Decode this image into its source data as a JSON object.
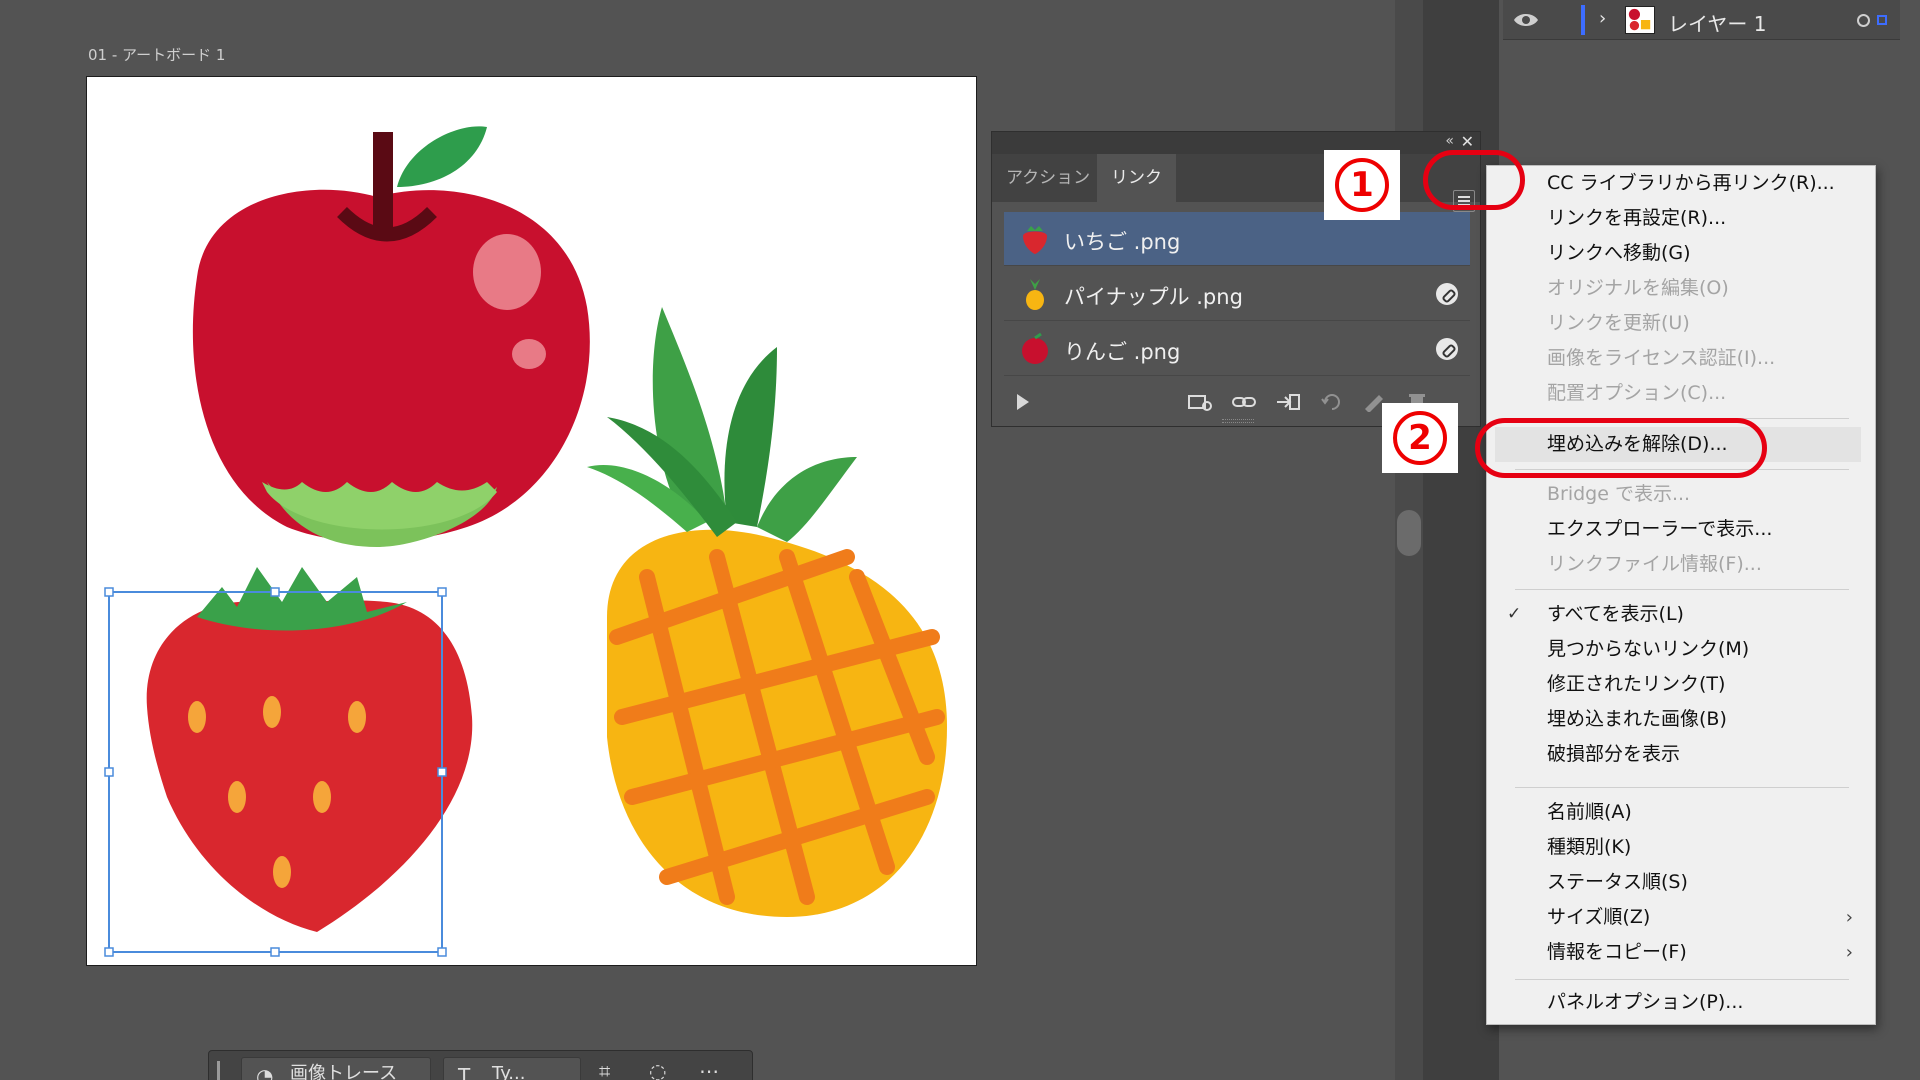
{
  "artboard": {
    "label": "01 - アートボード 1"
  },
  "layers": {
    "layer_name": "レイヤー 1"
  },
  "links_panel": {
    "tabs": [
      {
        "label": "アクション"
      },
      {
        "label": "リンク"
      }
    ],
    "items": [
      {
        "name": "いちご .png",
        "selected": true,
        "linked": false,
        "thumb": "strawberry-thumbnail"
      },
      {
        "name": "パイナップル .png",
        "selected": false,
        "linked": true,
        "thumb": "pineapple-thumbnail"
      },
      {
        "name": "りんご .png",
        "selected": false,
        "linked": true,
        "thumb": "apple-thumbnail"
      }
    ],
    "footer_icons": [
      "relink-from-cc-icon",
      "relink-icon",
      "go-to-link-icon",
      "update-link-icon",
      "edit-original-icon",
      "delete-icon"
    ]
  },
  "context_menu": {
    "items": [
      {
        "label": "CC ライブラリから再リンク(R)...",
        "enabled": true
      },
      {
        "label": "リンクを再設定(R)...",
        "enabled": true
      },
      {
        "label": "リンクへ移動(G)",
        "enabled": true
      },
      {
        "label": "オリジナルを編集(O)",
        "enabled": false
      },
      {
        "label": "リンクを更新(U)",
        "enabled": false
      },
      {
        "label": "画像をライセンス認証(I)...",
        "enabled": false
      },
      {
        "label": "配置オプション(C)...",
        "enabled": false
      },
      {
        "label": "埋め込みを解除(D)...",
        "enabled": true,
        "hovered": true
      },
      {
        "label": "Bridge で表示...",
        "enabled": false
      },
      {
        "label": "エクスプローラーで表示...",
        "enabled": true
      },
      {
        "label": "リンクファイル情報(F)...",
        "enabled": false
      },
      {
        "label": "すべてを表示(L)",
        "enabled": true,
        "checked": true
      },
      {
        "label": "見つからないリンク(M)",
        "enabled": true
      },
      {
        "label": "修正されたリンク(T)",
        "enabled": true
      },
      {
        "label": "埋め込まれた画像(B)",
        "enabled": true
      },
      {
        "label": "破損部分を表示",
        "enabled": true
      },
      {
        "label": "名前順(A)",
        "enabled": true
      },
      {
        "label": "種類別(K)",
        "enabled": true
      },
      {
        "label": "ステータス順(S)",
        "enabled": true
      },
      {
        "label": "サイズ順(Z)",
        "enabled": true,
        "submenu": true
      },
      {
        "label": "情報をコピー(F)",
        "enabled": true,
        "submenu": true
      },
      {
        "label": "パネルオプション(P)...",
        "enabled": true
      }
    ]
  },
  "annotations": {
    "step1": "1",
    "step2": "2",
    "color": "#e60012"
  },
  "bottom_toolbar": {
    "trace_label": "画像トレース",
    "type_label": "Ty..."
  },
  "colors": {
    "selection": "#4b6285",
    "accent": "#3d6dff"
  }
}
